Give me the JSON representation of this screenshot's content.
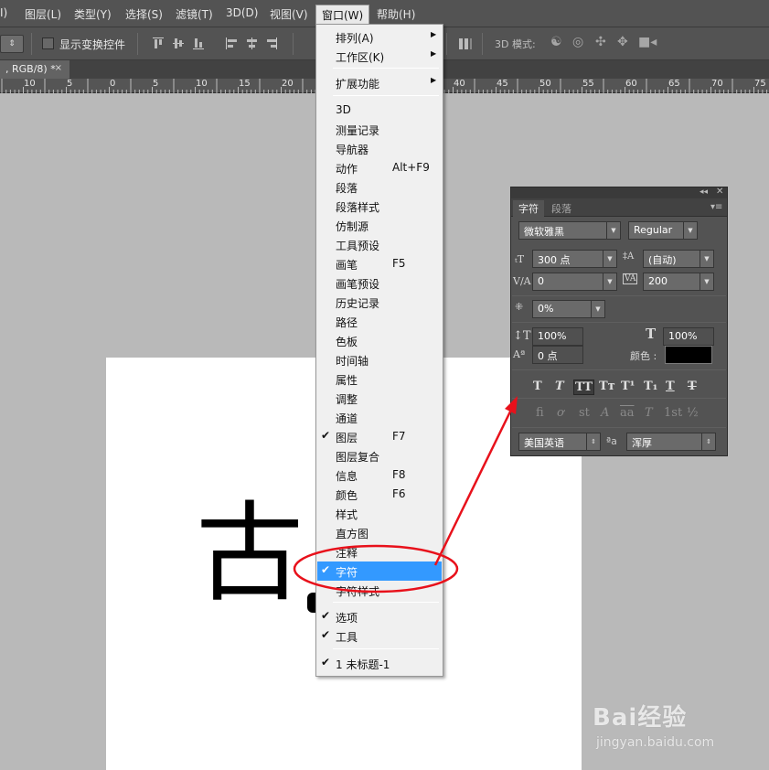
{
  "menubar": {
    "items": [
      "I)",
      "图层(L)",
      "类型(Y)",
      "选择(S)",
      "滤镜(T)",
      "3D(D)",
      "视图(V)",
      "窗口(W)",
      "帮助(H)"
    ]
  },
  "options_bar": {
    "show_transform_label": "显示变换控件",
    "mode_3d_label": "3D 模式:"
  },
  "document": {
    "tab_title": ", RGB/8) *",
    "close": "×",
    "canvas_glyph": "古"
  },
  "ruler": {
    "labels": [
      "10",
      "5",
      "0",
      "5",
      "10",
      "15",
      "20",
      "40",
      "45",
      "50",
      "55",
      "60",
      "65",
      "70",
      "75"
    ]
  },
  "window_menu": {
    "items": [
      {
        "label": "排列(A)",
        "submenu": true
      },
      {
        "label": "工作区(K)",
        "submenu": true
      },
      {
        "label": "扩展功能",
        "submenu": true
      },
      {
        "label": "3D"
      },
      {
        "label": "测量记录"
      },
      {
        "label": "导航器"
      },
      {
        "label": "动作",
        "shortcut": "Alt+F9"
      },
      {
        "label": "段落"
      },
      {
        "label": "段落样式"
      },
      {
        "label": "仿制源"
      },
      {
        "label": "工具预设"
      },
      {
        "label": "画笔",
        "shortcut": "F5"
      },
      {
        "label": "画笔预设"
      },
      {
        "label": "历史记录"
      },
      {
        "label": "路径"
      },
      {
        "label": "色板"
      },
      {
        "label": "时间轴"
      },
      {
        "label": "属性"
      },
      {
        "label": "调整"
      },
      {
        "label": "通道"
      },
      {
        "label": "图层",
        "shortcut": "F7",
        "checked": true
      },
      {
        "label": "图层复合"
      },
      {
        "label": "信息",
        "shortcut": "F8"
      },
      {
        "label": "颜色",
        "shortcut": "F6"
      },
      {
        "label": "样式"
      },
      {
        "label": "直方图"
      },
      {
        "label": "注释"
      },
      {
        "label": "字符",
        "checked": true,
        "highlighted": true
      },
      {
        "label": "字符样式"
      },
      {
        "label": "选项",
        "checked": true
      },
      {
        "label": "工具",
        "checked": true
      },
      {
        "label": "1 未标题-1",
        "checked": true
      }
    ]
  },
  "character_panel": {
    "tabs": [
      "字符",
      "段落"
    ],
    "font_family": "微软雅黑",
    "font_style": "Regular",
    "font_size": "300 点",
    "leading": "(自动)",
    "kerning": "0",
    "tracking": "200",
    "tsume": "0%",
    "vertical_scale": "100%",
    "horizontal_scale": "100%",
    "baseline_shift": "0 点",
    "color_label": "颜色 :",
    "text_color": "#000000",
    "language": "美国英语",
    "aa_label": "ªa",
    "antialias": "浑厚",
    "format_buttons": [
      "T",
      "T",
      "TT",
      "Tт",
      "T¹",
      "T₁",
      "T",
      "T"
    ],
    "opentype_buttons": [
      "fi",
      "ơ",
      "st",
      "A",
      "aa",
      "T",
      "1st",
      "½"
    ]
  },
  "annotation": {
    "color": "#e8111b"
  },
  "watermark": {
    "brand": "Bai经验",
    "url": "jingyan.baidu.com"
  }
}
